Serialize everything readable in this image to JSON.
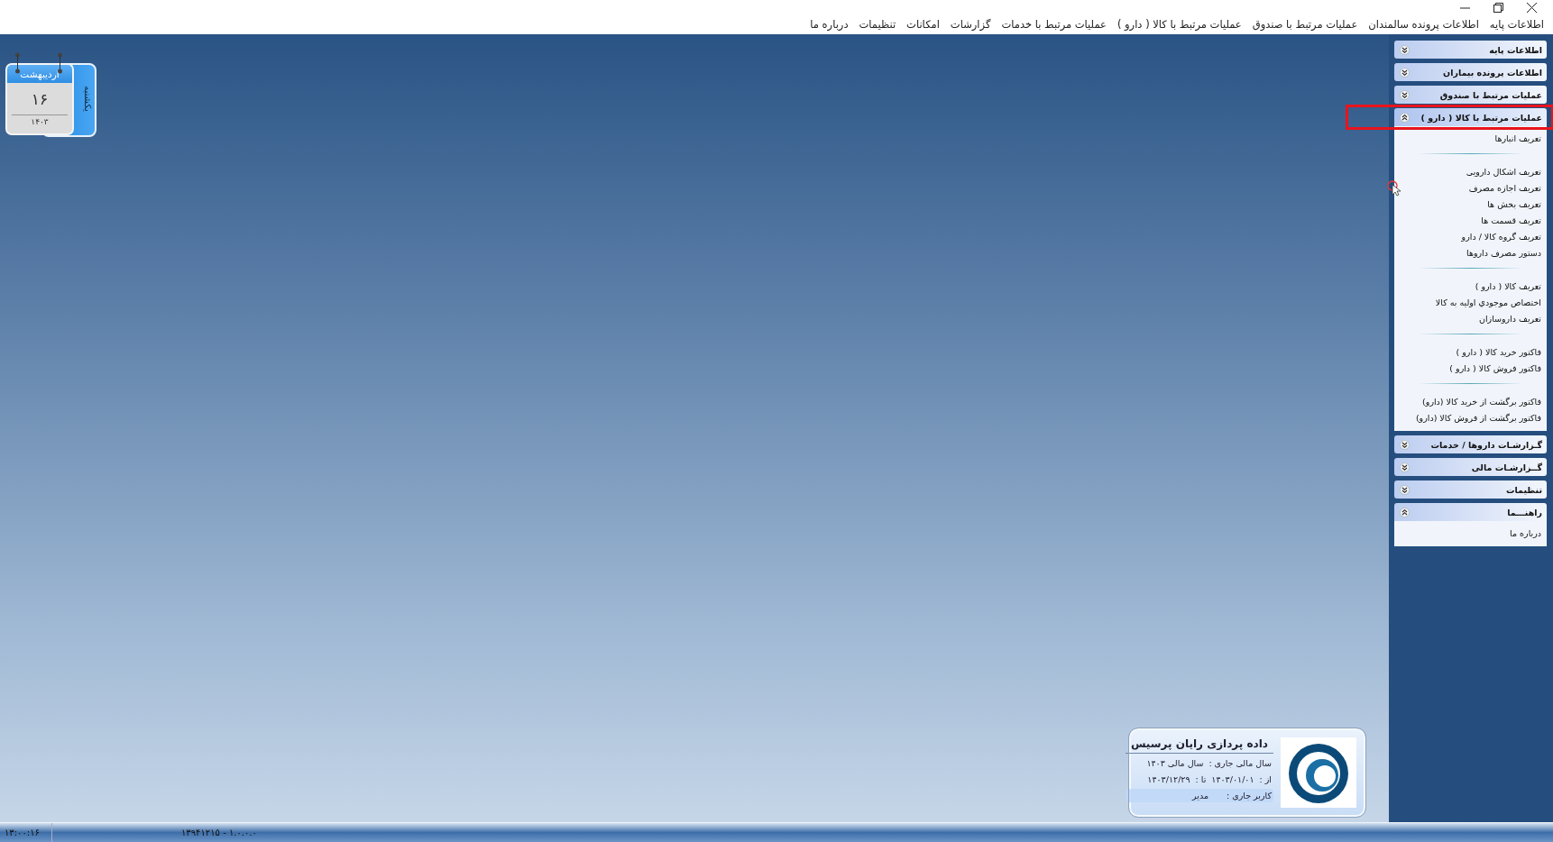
{
  "menu_bar": [
    "اطلاعات پایه",
    "اطلاعات پرونده سالمندان",
    "عملیات مرتبط با صندوق",
    "عملیات مرتبط با کالا ( دارو )",
    "عملیات مرتبط با خدمات",
    "گزارشات",
    "امکانات",
    "تنظیمات",
    "درباره ما"
  ],
  "calendar": {
    "month": "اردیبهشت",
    "day": "۱۶",
    "year": "۱۴۰۳",
    "weekday": "یکشنبه"
  },
  "sidebar": [
    {
      "title": "اطلاعات پایه",
      "expanded": false,
      "highlighted": false
    },
    {
      "title": "اطلاعات پرونده بیماران",
      "expanded": false,
      "highlighted": false
    },
    {
      "title": "عملیات مرتبط با صندوق",
      "expanded": false,
      "highlighted": false
    },
    {
      "title": "عملیات مرتبط با کالا ( دارو )",
      "expanded": true,
      "highlighted": true,
      "groups": [
        [
          {
            "label": "تعریف انبارها",
            "hovered": false
          }
        ],
        [
          {
            "label": "تعریف اشکال دارویی",
            "hovered": false
          },
          {
            "label": "تعریف اجازه مصرف",
            "hovered": true
          },
          {
            "label": "تعریف بخش ها",
            "hovered": false
          },
          {
            "label": "تعریف قسمت ها",
            "hovered": false
          },
          {
            "label": "تعریف گروه کالا / دارو",
            "hovered": false
          },
          {
            "label": "دستور مصرف داروها",
            "hovered": false
          }
        ],
        [
          {
            "label": "تعریف کالا ( دارو )",
            "hovered": false
          },
          {
            "label": "اختصاص موجودي اولیه به کالا",
            "hovered": false
          },
          {
            "label": "تعریف داروسازان",
            "hovered": false
          }
        ],
        [
          {
            "label": "فاکتور خرید کالا ( دارو )",
            "hovered": false
          },
          {
            "label": "فاکتور فروش کالا ( دارو )",
            "hovered": false
          }
        ],
        [
          {
            "label": "فاکتور برگشت از خرید کالا (دارو)",
            "hovered": false
          },
          {
            "label": "فاکتور برگشت از فروش کالا (دارو)",
            "hovered": false
          }
        ]
      ]
    },
    {
      "title": "گـزارشـات داروها / خدمات",
      "expanded": false,
      "highlighted": false
    },
    {
      "title": "گــزارشـات مالی",
      "expanded": false,
      "highlighted": false
    },
    {
      "title": "تنظیمات",
      "expanded": false,
      "highlighted": false
    },
    {
      "title": "راهنـــما",
      "expanded": true,
      "highlighted": false,
      "groups": [
        [
          {
            "label": "درباره ما",
            "hovered": false
          }
        ]
      ]
    }
  ],
  "company_card": {
    "name": "داده پردازی رایان پرسیس",
    "fiscal_year_label": "سال مالی جاری :",
    "fiscal_year": "سال مالی ۱۴۰۳",
    "from_label": "از :",
    "from": "۱۴۰۳/۰۱/۰۱",
    "to_label": "تا :",
    "to": "۱۴۰۳/۱۲/۲۹",
    "user_label": "کاربر جاری :",
    "user": "مدیر"
  },
  "status_bar": {
    "time": "۱۳:۰۰:۱۶",
    "version": "۱۳۹۴۱۲۱۵ - ۱.۰.۰.۰"
  }
}
